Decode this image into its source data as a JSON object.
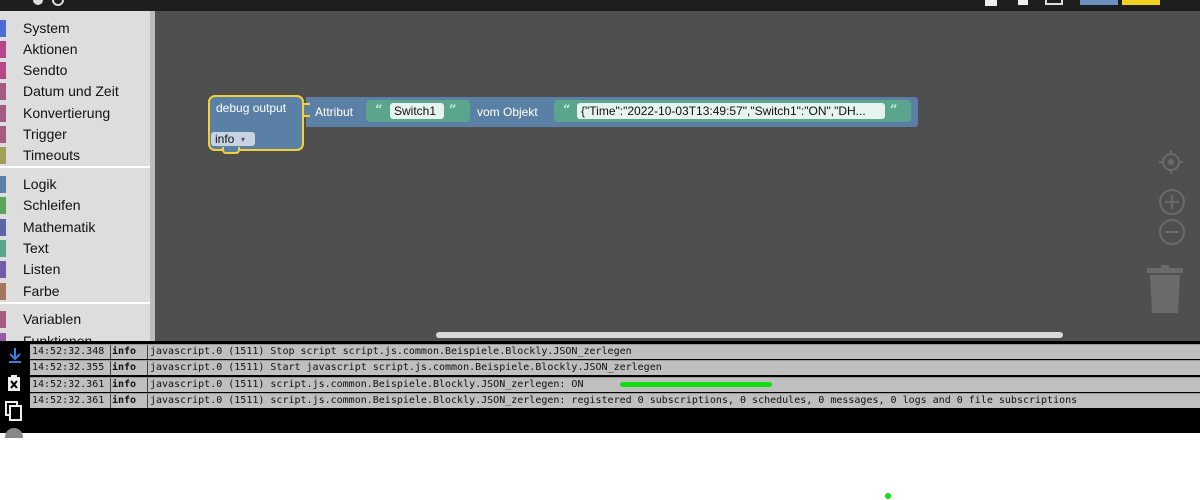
{
  "toolbox": {
    "categories": [
      {
        "label": "System",
        "color": "#4a6cd4"
      },
      {
        "label": "Aktionen",
        "color": "#b5478b"
      },
      {
        "label": "Sendto",
        "color": "#b5478b"
      },
      {
        "label": "Datum und Zeit",
        "color": "#a55b80"
      },
      {
        "label": "Konvertierung",
        "color": "#a55b80"
      },
      {
        "label": "Trigger",
        "color": "#a55b80"
      },
      {
        "label": "Timeouts",
        "color": "#a0a05b"
      },
      {
        "label": "Logik",
        "color": "#5b80a5"
      },
      {
        "label": "Schleifen",
        "color": "#5ba55b"
      },
      {
        "label": "Mathematik",
        "color": "#5b67a5"
      },
      {
        "label": "Text",
        "color": "#5ba58c"
      },
      {
        "label": "Listen",
        "color": "#745ba5"
      },
      {
        "label": "Farbe",
        "color": "#a5745b"
      },
      {
        "label": "Variablen",
        "color": "#a55b80"
      },
      {
        "label": "Funktionen",
        "color": "#995ba5"
      }
    ]
  },
  "block": {
    "title": "debug output",
    "level": "info",
    "attr_label": "Attribut",
    "attr_value": "Switch1",
    "object_label": "vom Objekt",
    "object_value": "{\"Time\":\"2022-10-03T13:49:57\",\"Switch1\":\"ON\",\"DH...",
    "open_quote": "“",
    "close_quote": "”",
    "dropdown_arrow": "▾"
  },
  "workspace": {
    "controls": [
      "crosshair-icon",
      "zoom-in-icon",
      "zoom-out-icon",
      "trash-icon"
    ]
  },
  "log": {
    "rows": [
      {
        "time": "14:52:32.348",
        "severity": "info",
        "message": "javascript.0 (1511) Stop script script.js.common.Beispiele.Blockly.JSON_zerlegen"
      },
      {
        "time": "14:52:32.355",
        "severity": "info",
        "message": "javascript.0 (1511) Start javascript script.js.common.Beispiele.Blockly.JSON_zerlegen"
      },
      {
        "time": "14:52:32.361",
        "severity": "info",
        "message": "javascript.0 (1511) script.js.common.Beispiele.Blockly.JSON_zerlegen: ON"
      },
      {
        "time": "14:52:32.361",
        "severity": "info",
        "message": "javascript.0 (1511) script.js.common.Beispiele.Blockly.JSON_zerlegen: registered 0 subscriptions, 0 schedules, 0 messages, 0 logs and 0 file subscriptions"
      }
    ],
    "tools": [
      "scroll-down-icon",
      "clear-log-icon",
      "copy-icon"
    ]
  },
  "colors": {
    "workspace_bg": "#4f4f4f",
    "block_blue": "#5b80a5",
    "text_block_green": "#5ba58c",
    "selection_yellow": "#f2cf3b"
  }
}
